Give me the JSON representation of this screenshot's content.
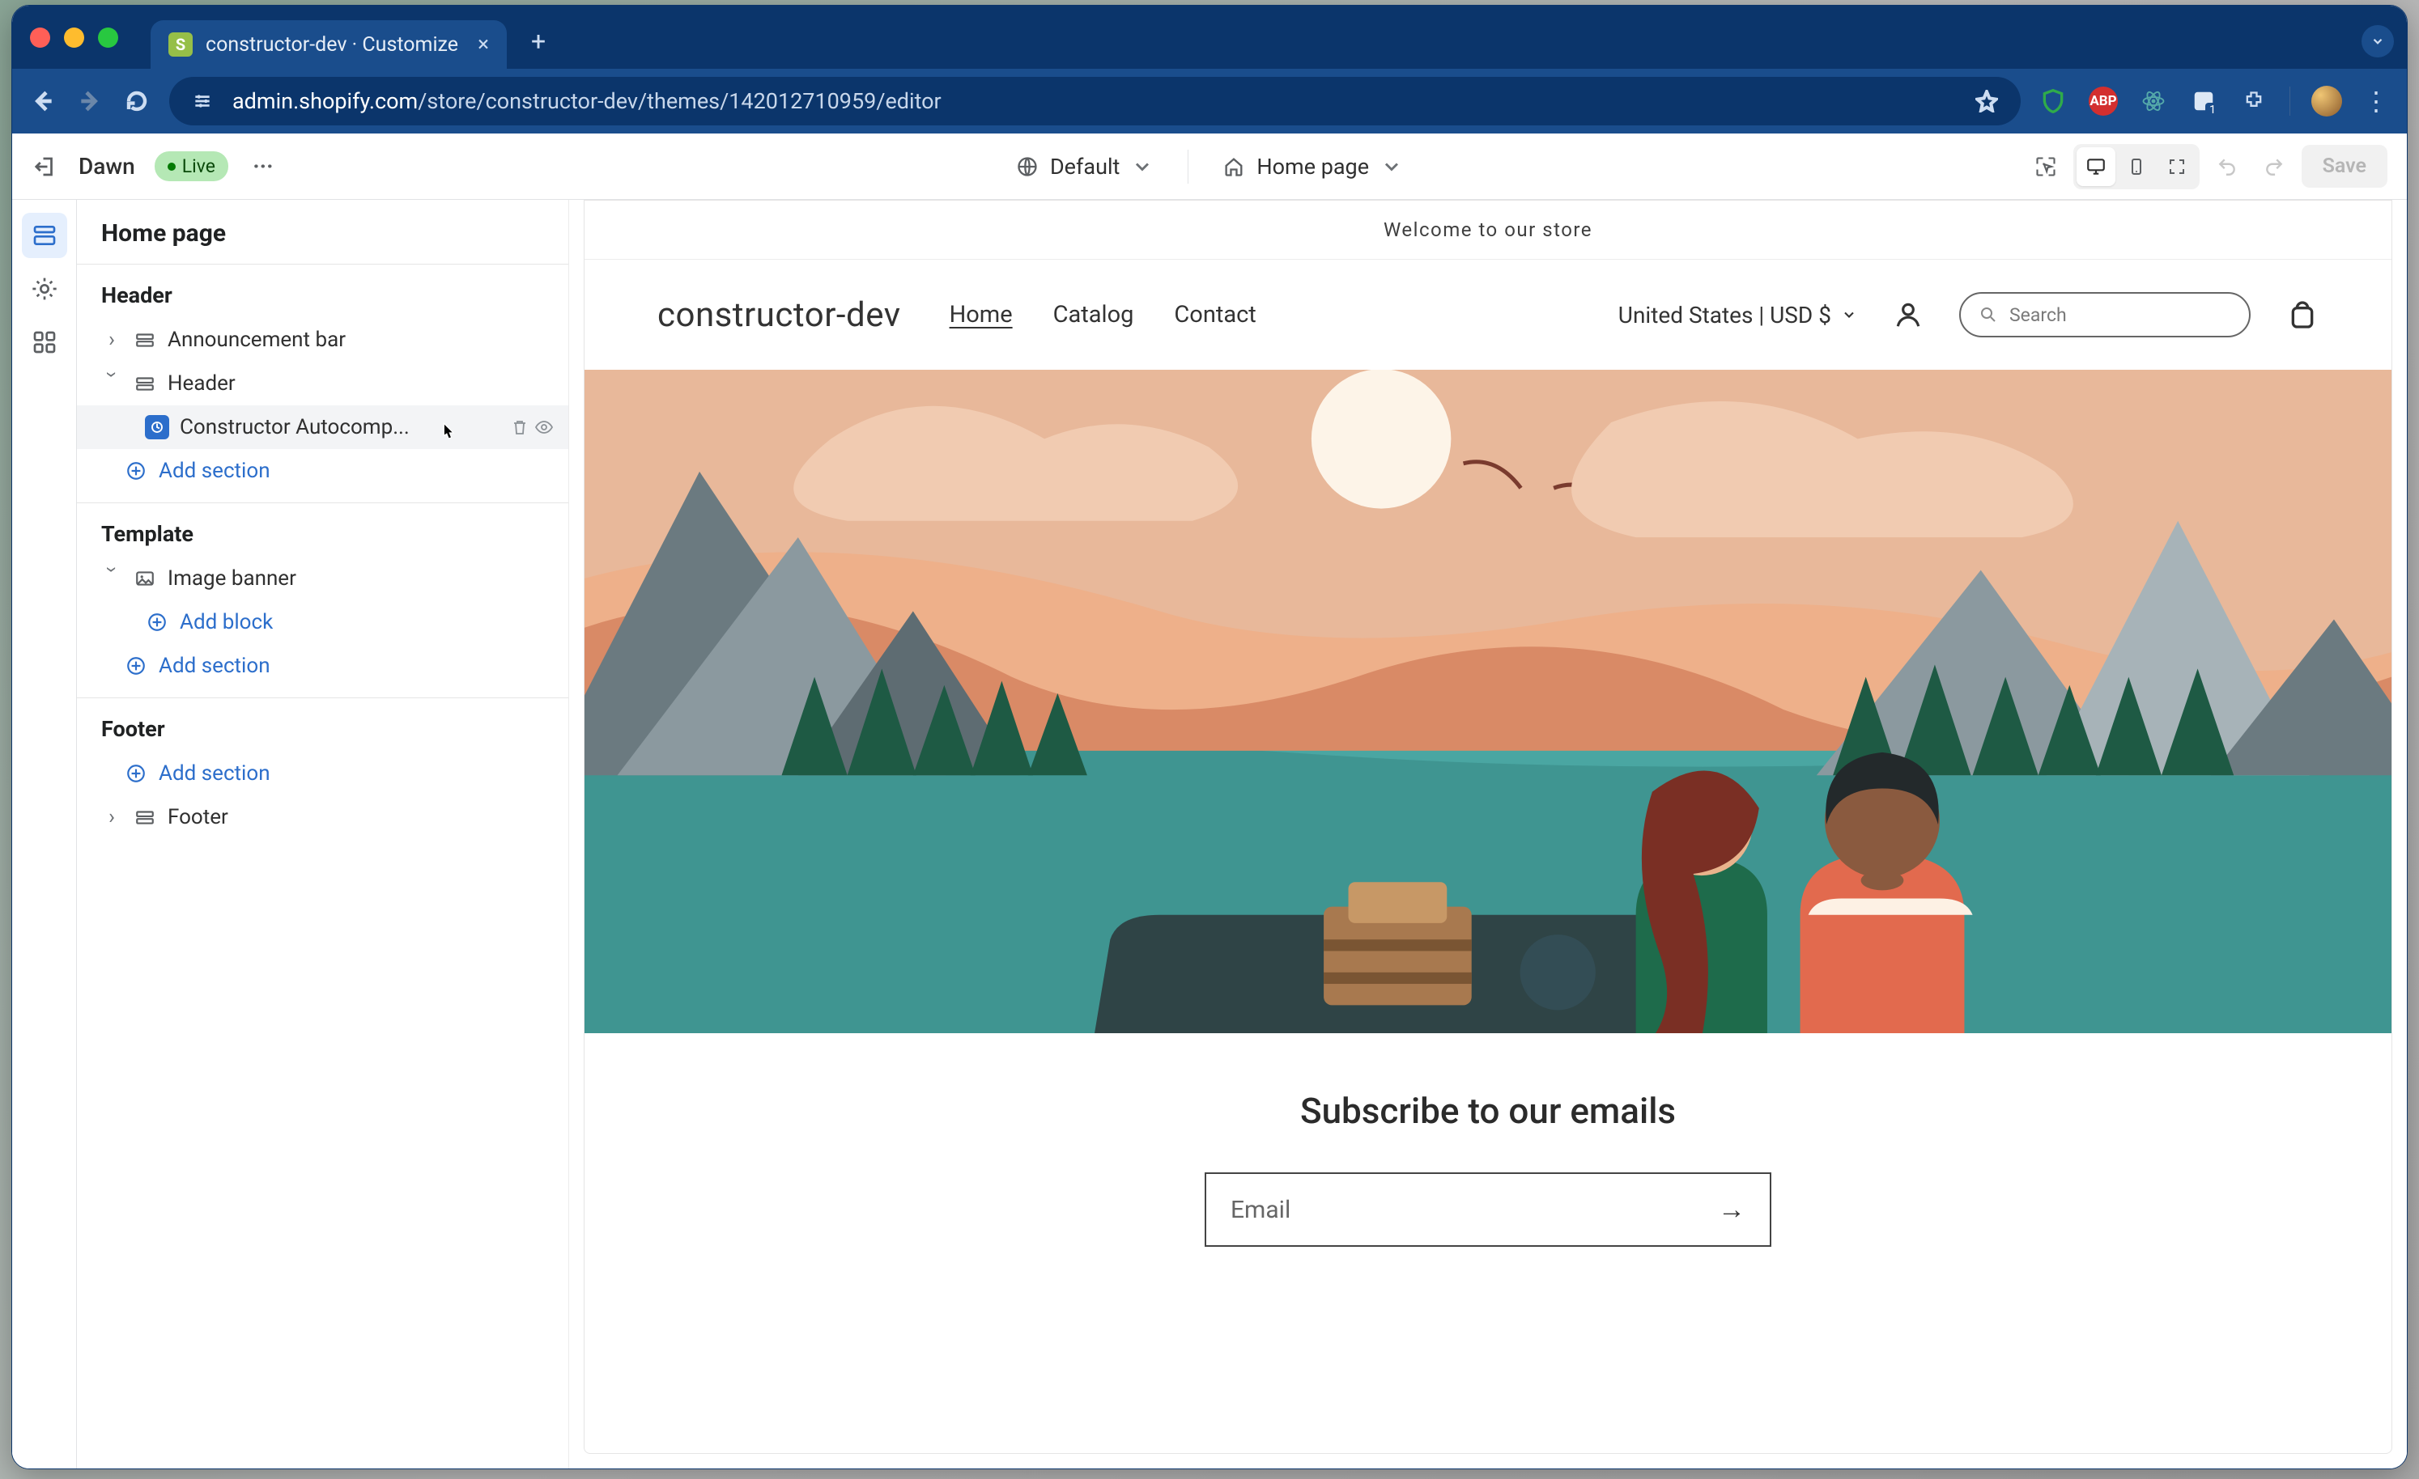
{
  "browser": {
    "tab_title": "constructor-dev · Customize",
    "url_host": "admin.shopify.com",
    "url_path": "/store/constructor-dev/themes/142012710959/editor",
    "extension_badge": "1",
    "abp_label": "ABP"
  },
  "topbar": {
    "theme_name": "Dawn",
    "status_badge": "Live",
    "preset_label": "Default",
    "page_label": "Home page",
    "save_label": "Save"
  },
  "sidebar": {
    "title": "Home page",
    "groups": [
      {
        "name": "Header",
        "items": [
          {
            "label": "Announcement bar",
            "expanded": false
          },
          {
            "label": "Header",
            "expanded": true,
            "children": [
              {
                "label": "Constructor Autocomp...",
                "app": true,
                "hovered": true
              }
            ]
          }
        ],
        "add_section": "Add section"
      },
      {
        "name": "Template",
        "items": [
          {
            "label": "Image banner",
            "expanded": true,
            "children": [],
            "add_block": "Add block"
          }
        ],
        "add_section": "Add section"
      },
      {
        "name": "Footer",
        "items": [
          {
            "label": "Footer",
            "expanded": false
          }
        ],
        "add_section": "Add section"
      }
    ]
  },
  "preview": {
    "announcement": "Welcome to our store",
    "store_name": "constructor-dev",
    "nav": [
      "Home",
      "Catalog",
      "Contact"
    ],
    "active_nav": "Home",
    "country": "United States | USD $",
    "search_placeholder": "Search",
    "subscribe_heading": "Subscribe to our emails",
    "email_label": "Email"
  }
}
